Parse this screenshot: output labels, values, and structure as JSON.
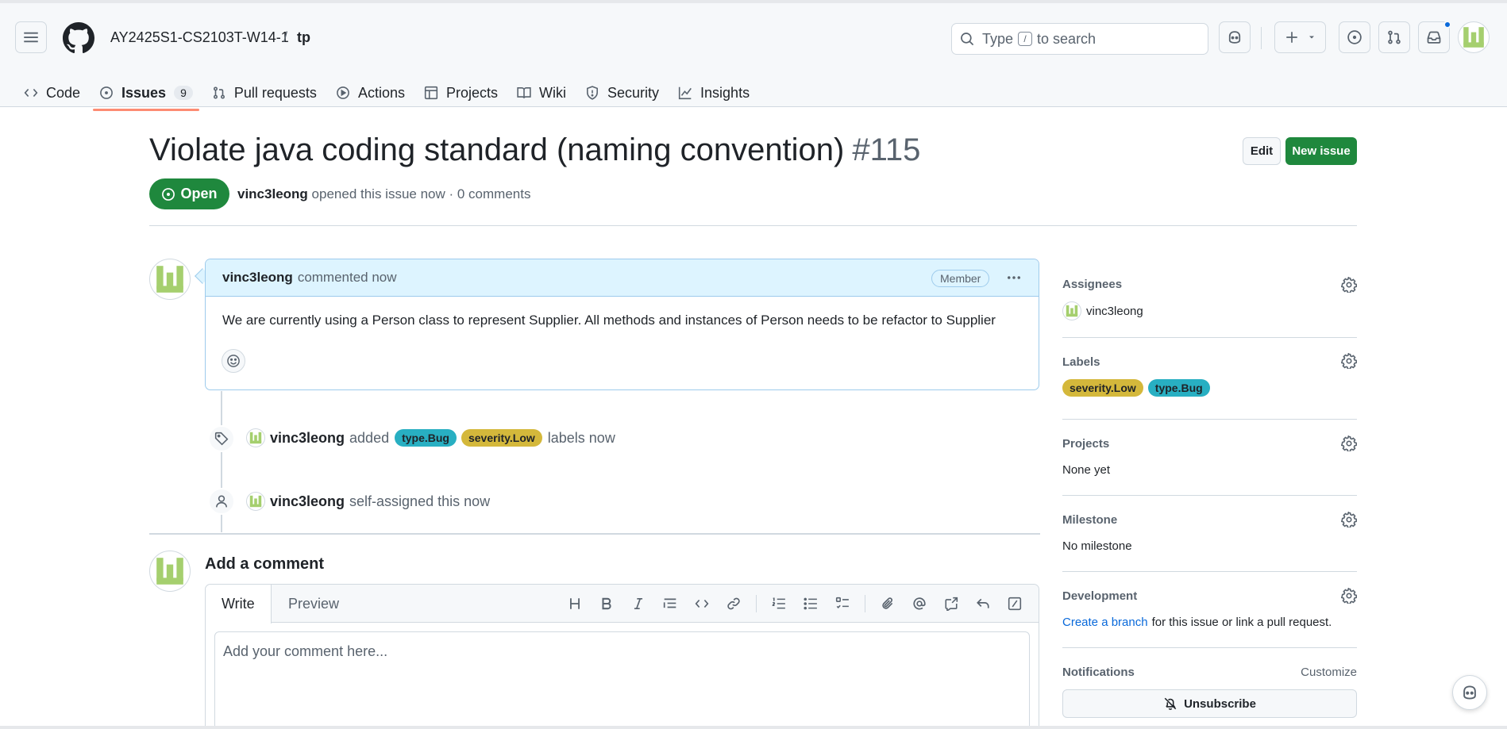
{
  "header": {
    "repo_owner": "AY2425S1-CS2103T-W14-1",
    "repo_separator": "/",
    "repo_name": "tp",
    "search_prefix": "Type",
    "search_key": "/",
    "search_suffix": "to search"
  },
  "nav": {
    "tabs": [
      {
        "label": "Code",
        "icon": "code-icon"
      },
      {
        "label": "Issues",
        "icon": "issue-opened-icon",
        "count": "9",
        "active": true
      },
      {
        "label": "Pull requests",
        "icon": "git-pull-request-icon"
      },
      {
        "label": "Actions",
        "icon": "play-icon"
      },
      {
        "label": "Projects",
        "icon": "table-icon"
      },
      {
        "label": "Wiki",
        "icon": "book-icon"
      },
      {
        "label": "Security",
        "icon": "shield-icon"
      },
      {
        "label": "Insights",
        "icon": "graph-icon"
      }
    ]
  },
  "issue": {
    "title": "Violate java coding standard (naming convention)",
    "number": "#115",
    "state": "Open",
    "author": "vinc3leong",
    "meta_text": "opened this issue now · 0 comments",
    "edit_label": "Edit",
    "new_issue_label": "New issue"
  },
  "comment": {
    "author": "vinc3leong",
    "action": "commented now",
    "role": "Member",
    "body": "We are currently using a Person class to represent Supplier. All methods and instances of Person needs to be refactor to Supplier"
  },
  "timeline": {
    "event1": {
      "author": "vinc3leong",
      "verb": "added",
      "label1": "type.Bug",
      "label2": "severity.Low",
      "suffix": "labels now"
    },
    "event2": {
      "author": "vinc3leong",
      "text": "self-assigned this now"
    }
  },
  "add_comment": {
    "title": "Add a comment",
    "tab_write": "Write",
    "tab_preview": "Preview",
    "placeholder": "Add your comment here..."
  },
  "sidebar": {
    "assignees_title": "Assignees",
    "assignee": "vinc3leong",
    "labels_title": "Labels",
    "labels": [
      "severity.Low",
      "type.Bug"
    ],
    "projects_title": "Projects",
    "projects_value": "None yet",
    "milestone_title": "Milestone",
    "milestone_value": "No milestone",
    "development_title": "Development",
    "development_link": "Create a branch",
    "development_text": "for this issue or link a pull request.",
    "notifications_title": "Notifications",
    "customize_label": "Customize",
    "unsubscribe_label": "Unsubscribe"
  },
  "colors": {
    "accent_green": "#1f883d",
    "link_blue": "#0969da",
    "label_bug": "#28afc2",
    "label_low": "#d4b83b",
    "comment_header": "#ddf4ff"
  }
}
